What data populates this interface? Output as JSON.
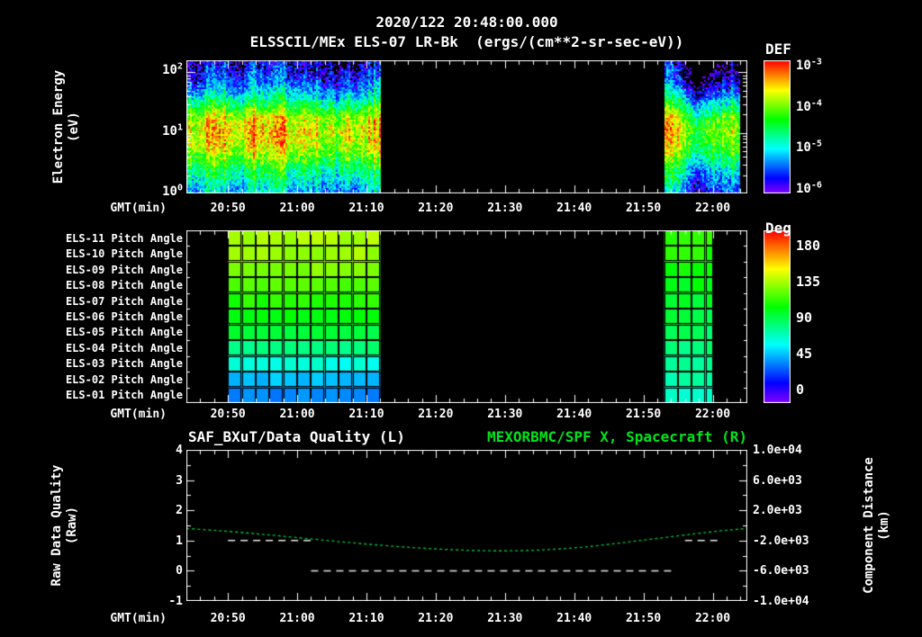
{
  "colors": {
    "background": "#000000",
    "text": "#ffffff",
    "accent_green": "#00e41c",
    "curve_green": "#00c832"
  },
  "header": {
    "datetime": "2020/122 20:48:00.000",
    "title": "ELSSCIL/MEx ELS-07 LR-Bk  (ergs/(cm**2-sr-sec-eV))"
  },
  "time_axis": {
    "label": "GMT(min)",
    "start": "20:44",
    "end": "22:05",
    "tick_labels": [
      "20:50",
      "21:00",
      "21:10",
      "21:20",
      "21:30",
      "21:40",
      "21:50",
      "22:00"
    ]
  },
  "panel1": {
    "ylabel_line1": "Electron Energy",
    "ylabel_line2": "(eV)",
    "ytick_exponents": [
      2,
      1,
      0
    ],
    "colorbar_title": "DEF",
    "colorbar_exponents": [
      -3,
      -4,
      -5,
      -6
    ]
  },
  "panel2": {
    "row_labels": [
      "ELS-11 Pitch Angle",
      "ELS-10 Pitch Angle",
      "ELS-09 Pitch Angle",
      "ELS-08 Pitch Angle",
      "ELS-07 Pitch Angle",
      "ELS-06 Pitch Angle",
      "ELS-05 Pitch Angle",
      "ELS-04 Pitch Angle",
      "ELS-03 Pitch Angle",
      "ELS-02 Pitch Angle",
      "ELS-01 Pitch Angle"
    ],
    "colorbar_title": "Deg",
    "colorbar_ticks": [
      180,
      135,
      90,
      45,
      0
    ]
  },
  "panel3": {
    "title_left": "SAF_BXuT/Data Quality (L)",
    "title_right": "MEXORBMC/SPF X, Spacecraft (R)",
    "ylabel_left_line1": "Raw Data Quality",
    "ylabel_left_line2": "(Raw)",
    "ylabel_right_line1": "Component Distance",
    "ylabel_right_line2": "(km)",
    "left_ticks": [
      "4",
      "3",
      "2",
      "1",
      "0",
      "-1"
    ],
    "right_ticks": [
      "1.0e+04",
      "6.0e+03",
      "2.0e+03",
      "-2.0e+03",
      "-6.0e+03",
      "-1.0e+04"
    ]
  },
  "chart_data": [
    {
      "type": "heatmap",
      "name": "electron-energy-spectrogram",
      "title": "ELSSCIL/MEx ELS-07 LR-Bk",
      "units": "ergs/(cm**2-sr-sec-eV)",
      "xlabel": "GMT(min)",
      "ylabel": "Electron Energy (eV)",
      "x_range": [
        "20:44",
        "22:05"
      ],
      "y_scale": "log",
      "y_range_ev": [
        1,
        158
      ],
      "colorbar": {
        "title": "DEF",
        "scale": "log",
        "min": 1e-06,
        "max": 0.001
      },
      "data_intervals": [
        {
          "start": "20:44",
          "end": "21:12"
        },
        {
          "start": "21:53",
          "end": "22:04"
        }
      ],
      "spectrum_profile": {
        "log10_energy_ev": [
          0.0,
          0.4,
          0.7,
          0.9,
          1.05,
          1.25,
          1.45,
          1.65,
          1.9,
          2.2
        ],
        "log10_flux": [
          -5.7,
          -5.0,
          -4.3,
          -4.05,
          -3.95,
          -4.15,
          -4.8,
          -5.5,
          -6.1,
          -6.45
        ]
      }
    },
    {
      "type": "heatmap",
      "name": "pitch-angle-panels",
      "xlabel": "GMT(min)",
      "rows": [
        "ELS-11",
        "ELS-10",
        "ELS-09",
        "ELS-08",
        "ELS-07",
        "ELS-06",
        "ELS-05",
        "ELS-04",
        "ELS-03",
        "ELS-02",
        "ELS-01"
      ],
      "colorbar": {
        "title": "Deg",
        "min": 0,
        "max": 180,
        "ticks": [
          180,
          135,
          90,
          45,
          0
        ]
      },
      "cell_minutes": 2,
      "intervals": [
        {
          "start": "20:50",
          "end": "21:12",
          "pitch_angles_deg": [
            127,
            125,
            121,
            114,
            106,
            99,
            92,
            82,
            66,
            52,
            42
          ]
        },
        {
          "start": "21:53",
          "end": "22:00",
          "pitch_angles_deg": [
            110,
            106,
            102,
            98,
            94,
            90,
            86,
            82,
            77,
            73,
            69
          ]
        }
      ]
    },
    {
      "type": "line",
      "name": "data-quality-and-spacecraft-x",
      "xlabel": "GMT(min)",
      "left_axis": {
        "label": "Raw Data Quality (Raw)",
        "min": -1,
        "max": 4,
        "ticks": [
          4,
          3,
          2,
          1,
          0,
          -1
        ]
      },
      "right_axis": {
        "label": "Component Distance (km)",
        "min": -10000,
        "max": 10000,
        "ticks": [
          10000,
          6000,
          2000,
          -2000,
          -6000,
          -10000
        ]
      },
      "series": [
        {
          "name": "MEXORBMC/SPF X, Spacecraft (R)",
          "axis": "right",
          "style": "dashed",
          "color": "#00c832",
          "x": [
            "20:44",
            "20:50",
            "21:00",
            "21:10",
            "21:20",
            "21:30",
            "21:40",
            "21:50",
            "22:00",
            "22:05"
          ],
          "y_km": [
            -400,
            -750,
            -1600,
            -2500,
            -3150,
            -3450,
            -3050,
            -1950,
            -800,
            -400
          ]
        },
        {
          "name": "SAF_BXuT/Data Quality (L)",
          "axis": "left",
          "style": "dashed",
          "color": "#e8e8e8",
          "segments": [
            {
              "start": "20:50",
              "end": "21:02",
              "value": 1
            },
            {
              "start": "21:02",
              "end": "21:54",
              "value": 0
            },
            {
              "start": "21:56",
              "end": "22:01",
              "value": 1
            }
          ]
        }
      ]
    }
  ]
}
